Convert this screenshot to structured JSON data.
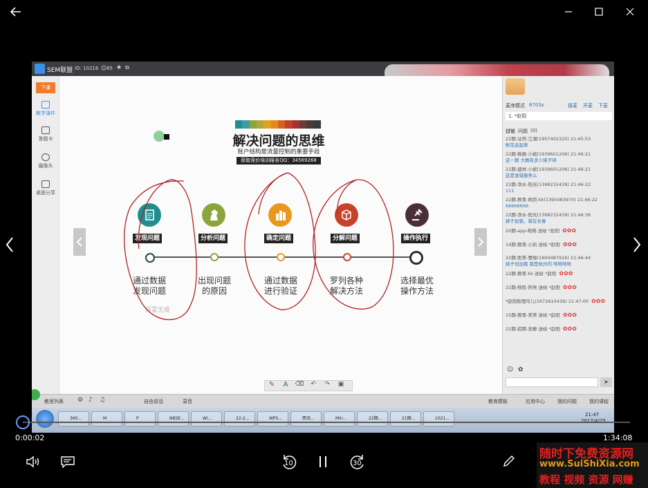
{
  "window": {
    "controls": [
      "back-icon",
      "minimize-icon",
      "maximize-icon",
      "close-icon"
    ]
  },
  "app": {
    "name": "SEM联盟",
    "id_text": "ID: 10216",
    "count": "85"
  },
  "left_panel": {
    "end_button": "下课",
    "items": [
      {
        "label": "教学课件",
        "icon": "courseware-icon"
      },
      {
        "label": "答题卡",
        "icon": "answer-card-icon"
      },
      {
        "label": "摄像头",
        "icon": "camera-icon"
      },
      {
        "label": "桌面分享",
        "icon": "desktop-share-icon"
      }
    ]
  },
  "slide": {
    "title": "解决问题的思维",
    "subtitle": "账户结构是流量控制的重要手段",
    "banner": "获取竞价培训报名QQ：34569268",
    "watermark": "挥霍无度",
    "palette": [
      "#1e8e8e",
      "#3a9e9e",
      "#8aa63a",
      "#b0a83a",
      "#e2a21c",
      "#e48a1c",
      "#d85e22",
      "#c2402a",
      "#a83232",
      "#6d3a3a",
      "#4a3a3a",
      "#3b3b3b"
    ],
    "steps": [
      {
        "label": "发现问题",
        "desc1": "通过数据",
        "desc2": "发现问题",
        "color": "#1e8e8e",
        "icon": "clipboard-icon"
      },
      {
        "label": "分析问题",
        "desc1": "出现问题",
        "desc2": "的原因",
        "color": "#8aa63a",
        "icon": "chess-knight-icon"
      },
      {
        "label": "确定问题",
        "desc1": "通过数据",
        "desc2": "进行验证",
        "color": "#e8981c",
        "icon": "grid-icon"
      },
      {
        "label": "分解问题",
        "desc1": "罗列各种",
        "desc2": "解决方法",
        "color": "#c7422b",
        "icon": "box-icon"
      },
      {
        "label": "操作执行",
        "desc1": "选择最优",
        "desc2": "操作方法",
        "color": "#4a3036",
        "icon": "gavel-icon"
      }
    ]
  },
  "chat": {
    "mode": "麦序模式",
    "mode_count": "8703s",
    "actions": [
      "接麦",
      "开麦",
      "下麦"
    ],
    "mic_user": "1. *赵阳",
    "tabs": [
      "讨论",
      "问题",
      "(0)"
    ],
    "messages": [
      {
        "u": "22期-淡然-江湖(1957402325) 21:45:53",
        "t": "鲜花走起来"
      },
      {
        "u": "22期-数据-小斌(1939601206) 21:46:21",
        "t": "这一期 大概有多少妹子呀"
      },
      {
        "u": "22期-建材-小斌(1939601206) 21:46:21",
        "t": "这是谁错服务么"
      },
      {
        "u": "22期-净水-阳光(1398232439) 21:46:22",
        "t": "111"
      },
      {
        "u": "22期-教育-网页-kk(1395483970) 21:46:22",
        "t": "66666666"
      },
      {
        "u": "22期-净水-阳光(1398232439) 21:46:36",
        "t": "妹子加我，我在长春"
      },
      {
        "u": "20期-app-皓皓 送给 *赵阳",
        "t": ""
      },
      {
        "u": "14期-教育-小凯 送给 *赵阳",
        "t": ""
      },
      {
        "u": "22期-医美-曹咖(1904487916) 21:46:44",
        "t": "妹子也加我 我是杭州的 哈哈哈哈"
      },
      {
        "u": "22期-教育-kk 送给 *赵阳",
        "t": ""
      },
      {
        "u": "22期-移民-阿亮 送给 *赵阳",
        "t": ""
      },
      {
        "u": "*赵阳助理玲儿(1672610439) 21:47:00",
        "t": ""
      },
      {
        "u": "15期-教育-美美 送给 *赵阳",
        "t": ""
      },
      {
        "u": "22期-招聘-安静 送给 *赵阳",
        "t": ""
      }
    ]
  },
  "toolbar": {
    "left": [
      "教室列表",
      "自由说话",
      "录音"
    ],
    "right": [
      "教育模板",
      "应用中心",
      "我的问题",
      "我的课程"
    ]
  },
  "taskbar": {
    "items": [
      "360...",
      "M",
      "P",
      "NBSE...",
      "Wi...",
      "22-2...",
      "WPS...",
      "西讯...",
      "Min...",
      "22期...",
      "21期...",
      "1021..."
    ],
    "clock": "21:47",
    "date": "2017/4/25"
  },
  "player": {
    "current_time": "0:00:02",
    "duration": "1:34:08",
    "progress": 0.0004,
    "rewind_label": "10",
    "forward_label": "30"
  },
  "watermark": {
    "line1": "随时下免费资源网",
    "line2": "www.SuiShiXia.com",
    "line3": "教程 视频 资源 网赚"
  }
}
